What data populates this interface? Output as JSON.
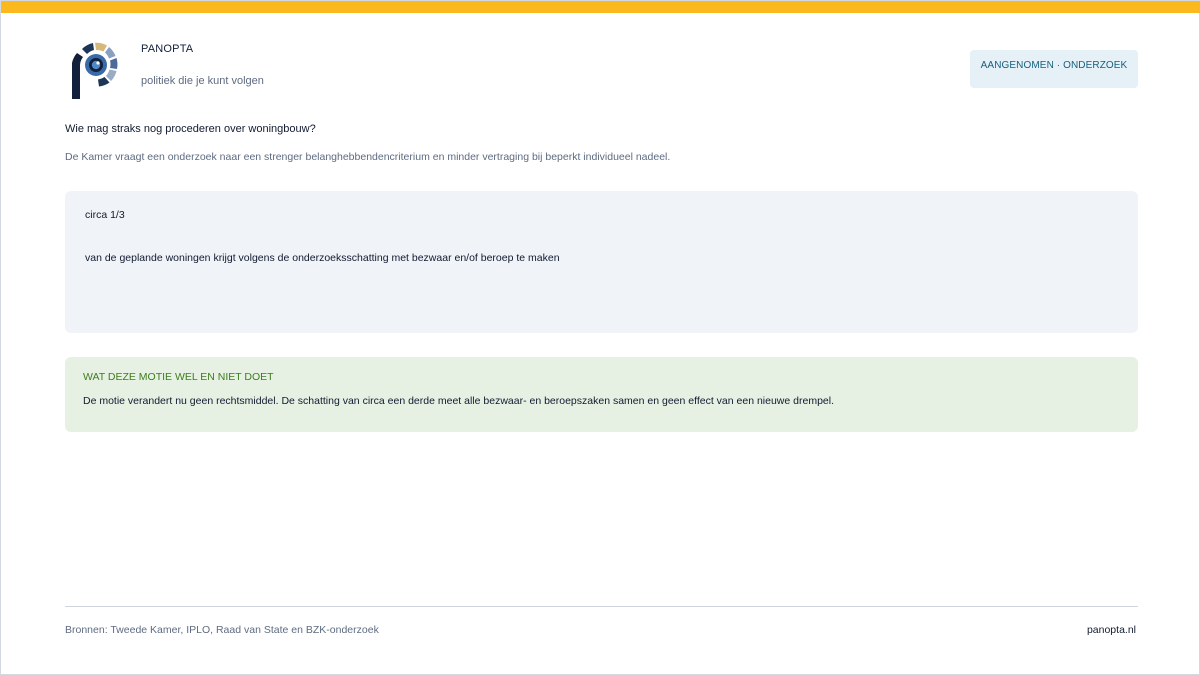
{
  "header": {
    "brand_name": "PANOPTA",
    "tagline": "politiek die je kunt volgen",
    "status_badge": "AANGENOMEN · ONDERZOEK",
    "logo_icon": "panopta-eye-logo-icon"
  },
  "main": {
    "title": "Wie mag straks nog procederen over woningbouw?",
    "subtitle": "De Kamer vraagt een onderzoek naar een strenger belanghebbendencriterium en minder vertraging bij beperkt individueel nadeel.",
    "stat": {
      "value": "circa 1/3",
      "description": "van de geplande woningen krijgt volgens de onderzoeksschatting met bezwaar en/of beroep te maken"
    },
    "note": {
      "heading": "WAT DEZE MOTIE WEL EN NIET DOET",
      "text": "De motie verandert nu geen rechtsmiddel. De schatting van circa een derde meet alle bezwaar- en beroepszaken samen en geen effect van een nieuwe drempel."
    }
  },
  "footer": {
    "sources": "Bronnen: Tweede Kamer, IPLO, Raad van State en BZK-onderzoek",
    "site": "panopta.nl"
  },
  "colors": {
    "accent_bar": "#fbb91d",
    "badge_bg": "#e6f0f7",
    "badge_text": "#16607f",
    "stat_card_bg": "#f0f3f7",
    "note_card_bg": "#e7f1e3",
    "note_heading": "#3c7d1e"
  }
}
